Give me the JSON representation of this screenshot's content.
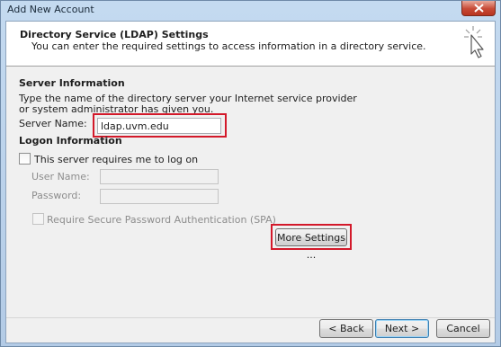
{
  "window": {
    "title": "Add New Account"
  },
  "header": {
    "title": "Directory Service (LDAP) Settings",
    "description": "You can enter the required settings to access information in a directory service."
  },
  "server_info": {
    "heading": "Server Information",
    "description": "Type the name of the directory server your Internet service provider or system administrator has given you.",
    "server_name_label": "Server Name:",
    "server_name_value": "ldap.uvm.edu"
  },
  "logon_info": {
    "heading": "Logon Information",
    "requires_logon_label": "This server requires me to log on",
    "requires_logon_checked": false,
    "username_label": "User Name:",
    "username_value": "",
    "password_label": "Password:",
    "password_value": "",
    "spa_label": "Require Secure Password Authentication (SPA)",
    "spa_checked": false
  },
  "buttons": {
    "more_settings": "More Settings ...",
    "back": "< Back",
    "next": "Next >",
    "cancel": "Cancel"
  },
  "colors": {
    "highlight": "#d3192a",
    "window_frame": "#bcd3ea"
  }
}
